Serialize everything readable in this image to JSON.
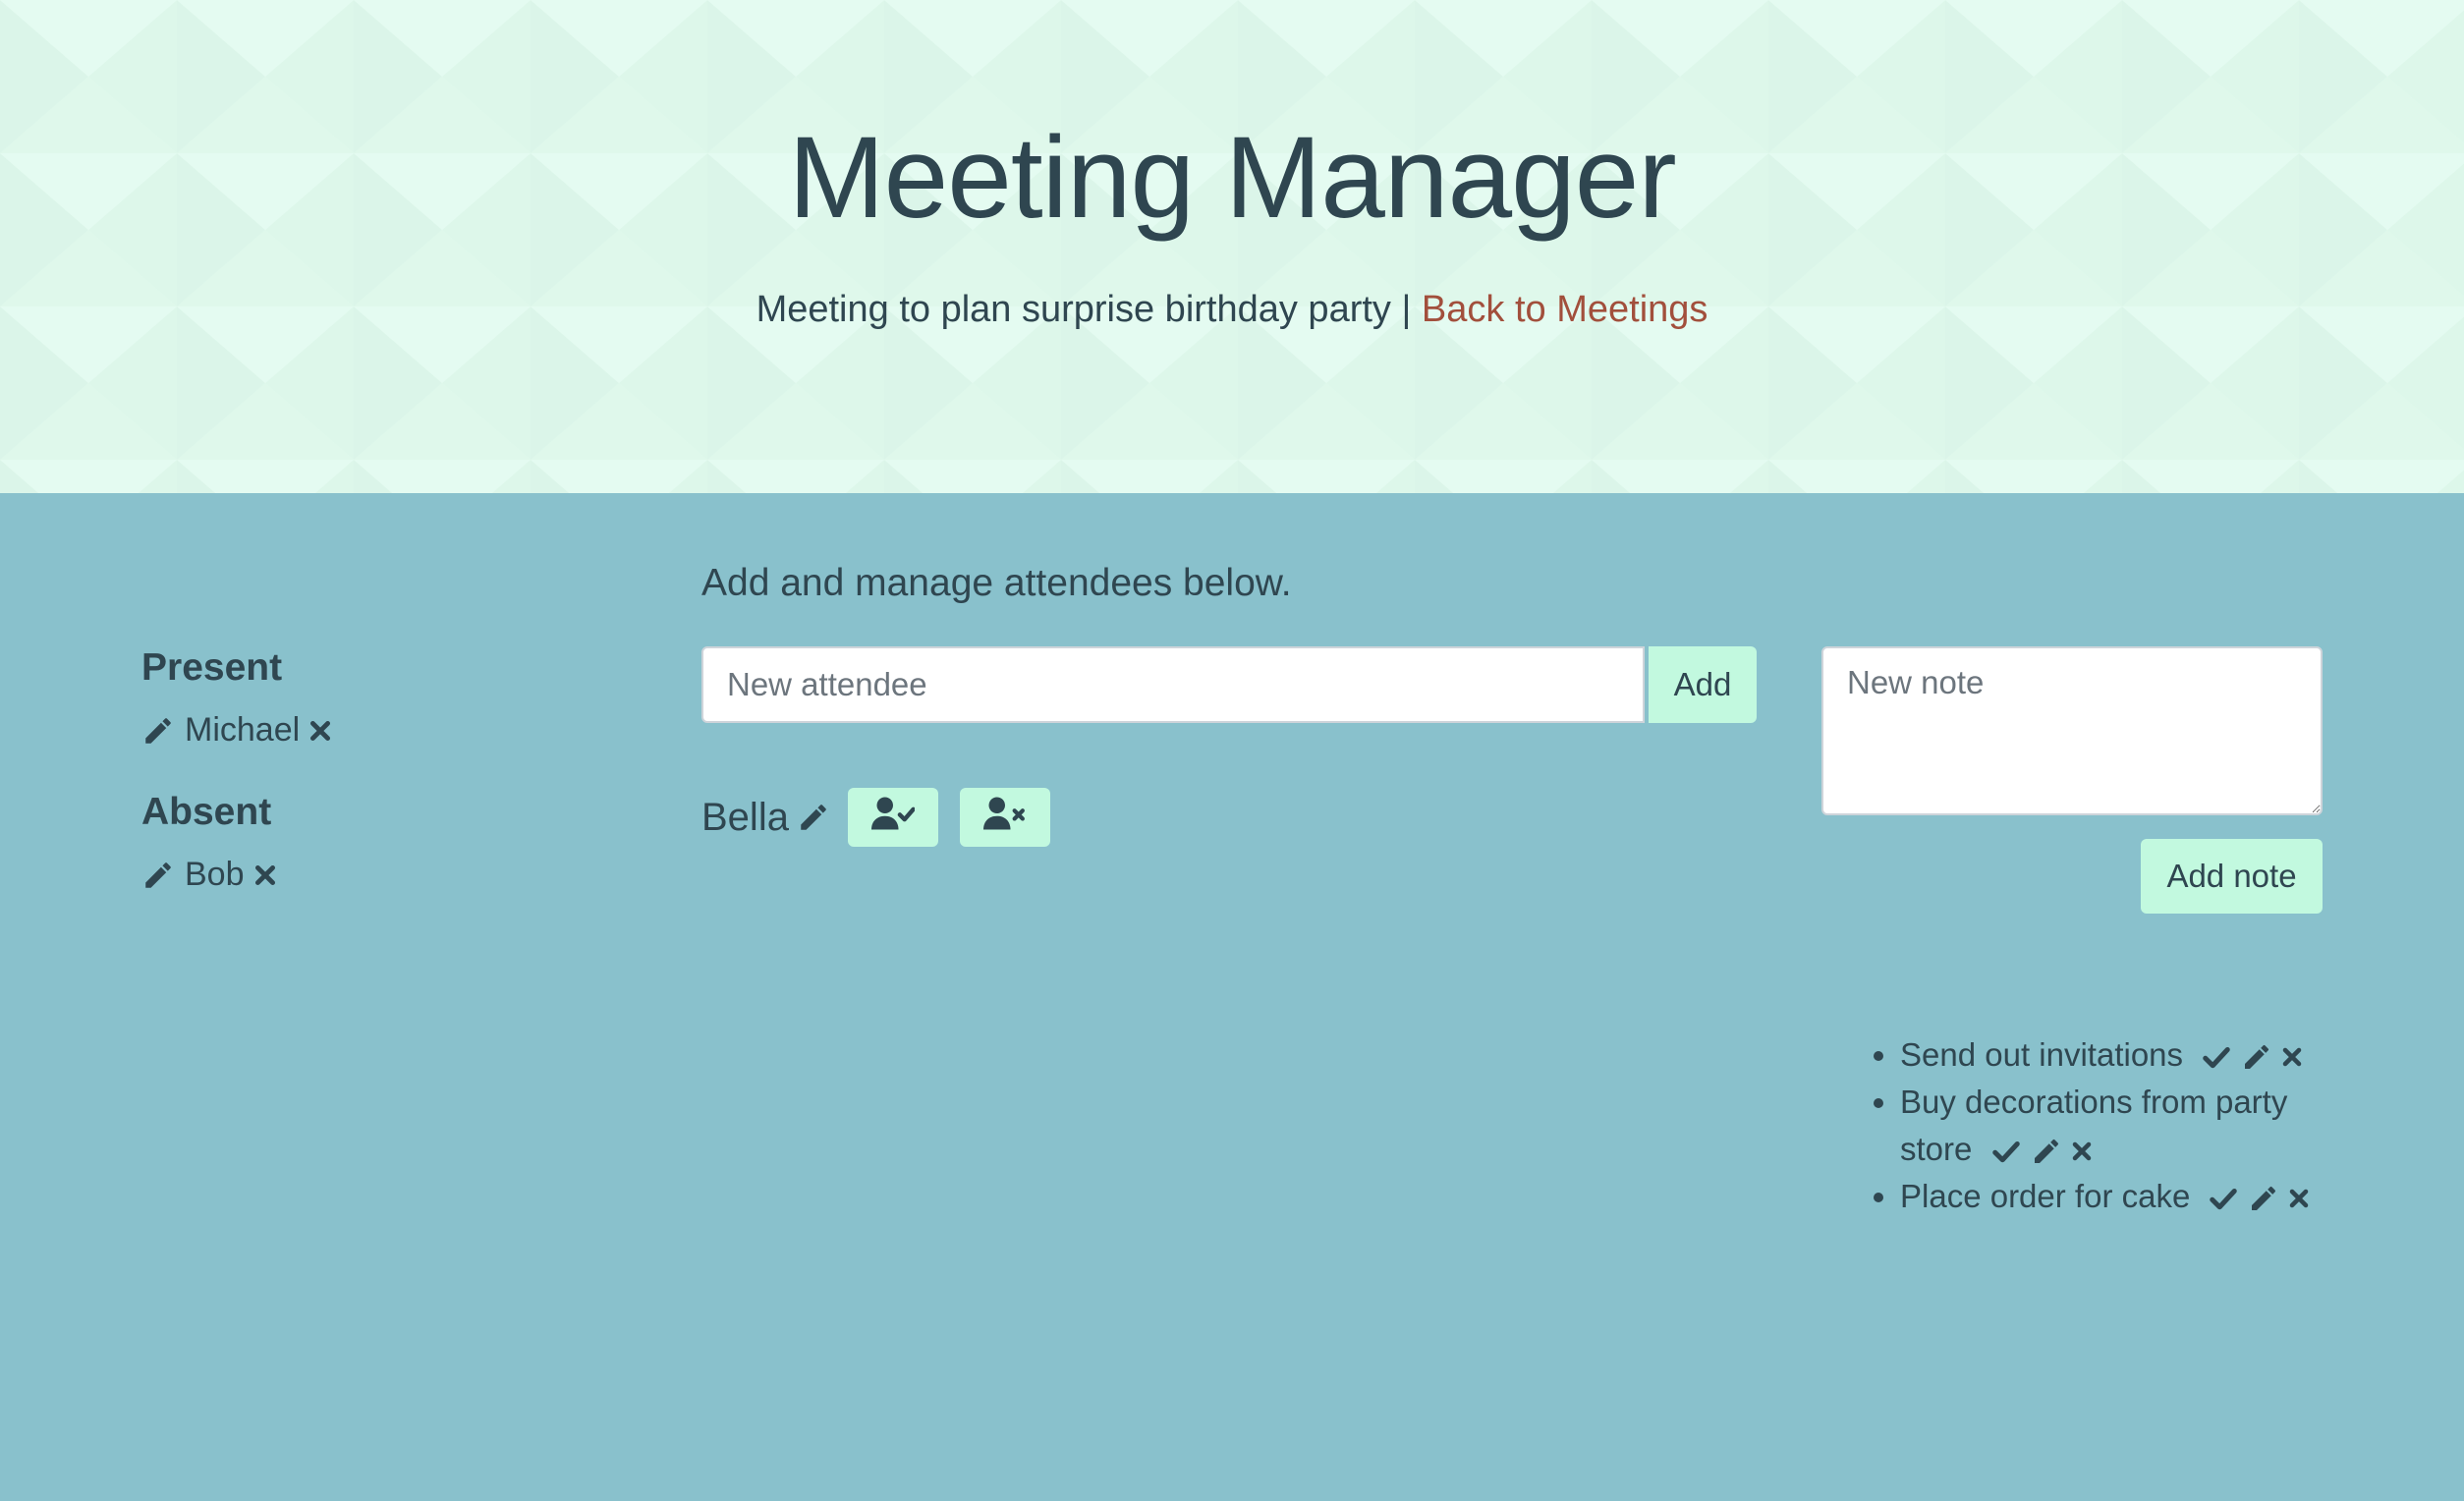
{
  "header": {
    "title": "Meeting Manager",
    "subtitle": "Meeting to plan surprise birthday party",
    "separator": "|",
    "back_link": "Back to Meetings"
  },
  "attendance": {
    "present_heading": "Present",
    "present": [
      "Michael"
    ],
    "absent_heading": "Absent",
    "absent": [
      "Bob"
    ]
  },
  "attendee_form": {
    "intro": "Add and manage attendees below.",
    "placeholder": "New attendee",
    "add_label": "Add",
    "pending": [
      "Bella"
    ]
  },
  "notes": {
    "placeholder": "New note",
    "add_label": "Add note",
    "items": [
      "Send out invitations",
      "Buy decorations from party store",
      "Place order for cake"
    ]
  },
  "icons": {
    "edit": "pencil-icon",
    "delete": "close-icon",
    "complete": "check-icon",
    "mark_present": "user-check-icon",
    "mark_absent": "user-times-icon"
  },
  "colors": {
    "header_bg": "#e2fbef",
    "main_bg": "#89c1cc",
    "button_bg": "#c2f9df",
    "text": "#2f4650",
    "link": "#a24f3c"
  }
}
